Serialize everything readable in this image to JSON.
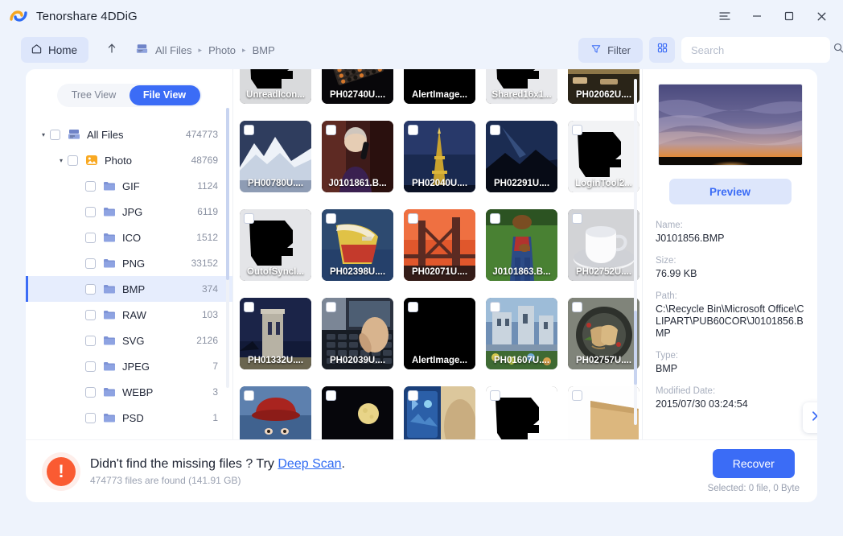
{
  "app": {
    "title": "Tenorshare 4DDiG",
    "logo_icon": "4ddig-logo-icon"
  },
  "window_controls": {
    "menu_label": "☰",
    "minimize_label": "–",
    "maximize_label": "□",
    "close_label": "✕"
  },
  "toolbar": {
    "home_label": "Home",
    "home_icon": "home-icon",
    "up_icon": "arrow-up-icon",
    "drive_icon": "drive-icon",
    "breadcrumbs": [
      "All Files",
      "Photo",
      "BMP"
    ],
    "separator": "▸",
    "filter_label": "Filter",
    "filter_icon": "funnel-icon",
    "grid_icon": "grid-view-icon",
    "search_placeholder": "Search",
    "search_value": "",
    "search_icon": "search-icon"
  },
  "sidebar": {
    "toggle": {
      "tree_view": "Tree View",
      "file_view": "File View",
      "active": "File View"
    },
    "tree": [
      {
        "label": "All Files",
        "count": "474773",
        "indent": 0,
        "icon": "drive-icon",
        "caret": "▾",
        "selected": false
      },
      {
        "label": "Photo",
        "count": "48769",
        "indent": 1,
        "icon": "photo-icon",
        "caret": "▾",
        "selected": false
      },
      {
        "label": "GIF",
        "count": "1124",
        "indent": 2,
        "icon": "folder-icon",
        "caret": "",
        "selected": false
      },
      {
        "label": "JPG",
        "count": "6119",
        "indent": 2,
        "icon": "folder-icon",
        "caret": "",
        "selected": false
      },
      {
        "label": "ICO",
        "count": "1512",
        "indent": 2,
        "icon": "folder-icon",
        "caret": "",
        "selected": false
      },
      {
        "label": "PNG",
        "count": "33152",
        "indent": 2,
        "icon": "folder-icon",
        "caret": "",
        "selected": false
      },
      {
        "label": "BMP",
        "count": "374",
        "indent": 2,
        "icon": "folder-icon",
        "caret": "",
        "selected": true
      },
      {
        "label": "RAW",
        "count": "103",
        "indent": 2,
        "icon": "folder-icon",
        "caret": "",
        "selected": false
      },
      {
        "label": "SVG",
        "count": "2126",
        "indent": 2,
        "icon": "folder-icon",
        "caret": "",
        "selected": false
      },
      {
        "label": "JPEG",
        "count": "7",
        "indent": 2,
        "icon": "folder-icon",
        "caret": "",
        "selected": false
      },
      {
        "label": "WEBP",
        "count": "3",
        "indent": 2,
        "icon": "folder-icon",
        "caret": "",
        "selected": false
      },
      {
        "label": "PSD",
        "count": "1",
        "indent": 2,
        "icon": "folder-icon",
        "caret": "",
        "selected": false
      }
    ]
  },
  "file_grid": {
    "rows": [
      [
        {
          "name": "UnreadIcon...",
          "kind": "mask-black",
          "c1": "#d9dadc",
          "c2": "#8e9095"
        },
        {
          "name": "PH02740U....",
          "kind": "abacus",
          "c1": "#3a2a1c",
          "c2": "#0d0b0a"
        },
        {
          "name": "AlertImage...",
          "kind": "solid-black",
          "c1": "#000000",
          "c2": "#000000"
        },
        {
          "name": "Shared16x1...",
          "kind": "mask-black",
          "c1": "#e8e9ec",
          "c2": "#9a9ca1"
        },
        {
          "name": "PH02062U....",
          "kind": "cityscape",
          "c1": "#b79a6d",
          "c2": "#3a3324"
        }
      ],
      [
        {
          "name": "PH00780U....",
          "kind": "mountain",
          "c1": "#2c3a5c",
          "c2": "#e9eef6"
        },
        {
          "name": "J0101861.B...",
          "kind": "portrait",
          "c1": "#5a2421",
          "c2": "#150a09"
        },
        {
          "name": "PH02040U....",
          "kind": "eiffel",
          "c1": "#24345e",
          "c2": "#0a1122"
        },
        {
          "name": "PH02291U....",
          "kind": "nightsky",
          "c1": "#16243f",
          "c2": "#05070e"
        },
        {
          "name": "LoginTool2...",
          "kind": "mask-black",
          "c1": "#f2f3f5",
          "c2": "#a0a2a7"
        }
      ],
      [
        {
          "name": "OutofSyncI...",
          "kind": "mask-black",
          "c1": "#e4e5e8",
          "c2": "#8c8e93"
        },
        {
          "name": "PH02398U....",
          "kind": "boat",
          "c1": "#2e4a6e",
          "c2": "#c8a23a"
        },
        {
          "name": "PH02071U....",
          "kind": "bridge",
          "c1": "#d8502e",
          "c2": "#2a1a18"
        },
        {
          "name": "J0101863.B...",
          "kind": "field",
          "c1": "#3c6a2a",
          "c2": "#20431a"
        },
        {
          "name": "PH02752U....",
          "kind": "cup",
          "c1": "#d7d8da",
          "c2": "#8d8f94"
        }
      ],
      [
        {
          "name": "PH01332U....",
          "kind": "tower",
          "c1": "#131c3a",
          "c2": "#6a6e86"
        },
        {
          "name": "PH02039U....",
          "kind": "keyboard",
          "c1": "#7a8494",
          "c2": "#10151c"
        },
        {
          "name": "AlertImage...",
          "kind": "solid-black",
          "c1": "#000000",
          "c2": "#000000"
        },
        {
          "name": "PH01607U....",
          "kind": "castle",
          "c1": "#8aa4c0",
          "c2": "#2a3a28"
        },
        {
          "name": "PH02757U....",
          "kind": "plate",
          "c1": "#7e8277",
          "c2": "#2b2d27"
        }
      ],
      [
        {
          "name": "",
          "kind": "hat",
          "c1": "#3c5f92",
          "c2": "#b02b2b"
        },
        {
          "name": "",
          "kind": "moon",
          "c1": "#06060a",
          "c2": "#e8d488"
        },
        {
          "name": "",
          "kind": "tablet",
          "c1": "#1a3f7a",
          "c2": "#cdb78e"
        },
        {
          "name": "",
          "kind": "mask-black",
          "c1": "#ffffff",
          "c2": "#000000"
        },
        {
          "name": "",
          "kind": "paper",
          "c1": "#ffffff",
          "c2": "#d8b77e"
        }
      ]
    ]
  },
  "details": {
    "preview_label": "Preview",
    "preview_image_alt": "sunset-clouds-thumbnail",
    "fields": [
      {
        "label": "Name:",
        "value": "J0101856.BMP"
      },
      {
        "label": "Size:",
        "value": "76.99 KB"
      },
      {
        "label": "Path:",
        "value": "C:\\Recycle Bin\\Microsoft Office\\CLIPART\\PUB60COR\\J0101856.BMP"
      },
      {
        "label": "Type:",
        "value": "BMP"
      },
      {
        "label": "Modified Date:",
        "value": "2015/07/30 03:24:54"
      }
    ],
    "next_icon": "chevron-right-icon"
  },
  "bottom": {
    "warn_icon": "alert-exclamation-icon",
    "message_prefix": "Didn't find the missing files ? Try ",
    "link_label": "Deep Scan",
    "message_suffix": ".",
    "sub_text": "474773 files are found (141.91 GB)",
    "recover_label": "Recover",
    "selected_text": "Selected: 0 file, 0 Byte"
  },
  "colors": {
    "accent": "#3b6cf6",
    "accent_soft": "#dde6fb",
    "warn": "#fa5b32",
    "page_bg": "#eef3fc"
  }
}
